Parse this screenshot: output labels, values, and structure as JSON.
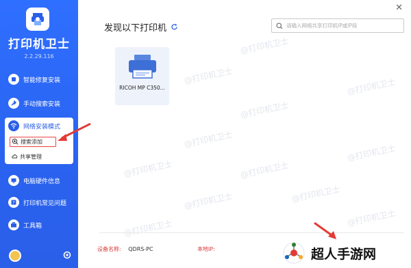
{
  "app": {
    "title": "打印机卫士",
    "version": "2.2.29.116"
  },
  "sidebar": {
    "items": [
      {
        "label": "智能修复安装",
        "icon": "repair-icon"
      },
      {
        "label": "手动搜索安装",
        "icon": "wrench-icon"
      },
      {
        "label": "网络安装模式",
        "icon": "network-icon"
      },
      {
        "label": "电脑硬件信息",
        "icon": "hardware-icon"
      },
      {
        "label": "打印机常见问题",
        "icon": "question-icon"
      },
      {
        "label": "工具箱",
        "icon": "toolbox-icon"
      }
    ],
    "sub_items": [
      {
        "label": "搜索添加",
        "icon": "search-plus-icon"
      },
      {
        "label": "共享管理",
        "icon": "cloud-icon"
      }
    ]
  },
  "main": {
    "title": "发现以下打印机",
    "search_placeholder": "请输入网络共享打印机IP或IP段",
    "printers": [
      {
        "name": "RICOH MP C350..."
      }
    ]
  },
  "watermark_text": "@打印机卫士",
  "footer": {
    "device_label": "设备名称:",
    "device_value": "QDRS-PC",
    "ip_label": "本地IP:"
  },
  "brand": {
    "text": "超人手游网"
  },
  "colors": {
    "sidebar_blue": "#2a5fe8",
    "accent_red": "#e94040"
  }
}
